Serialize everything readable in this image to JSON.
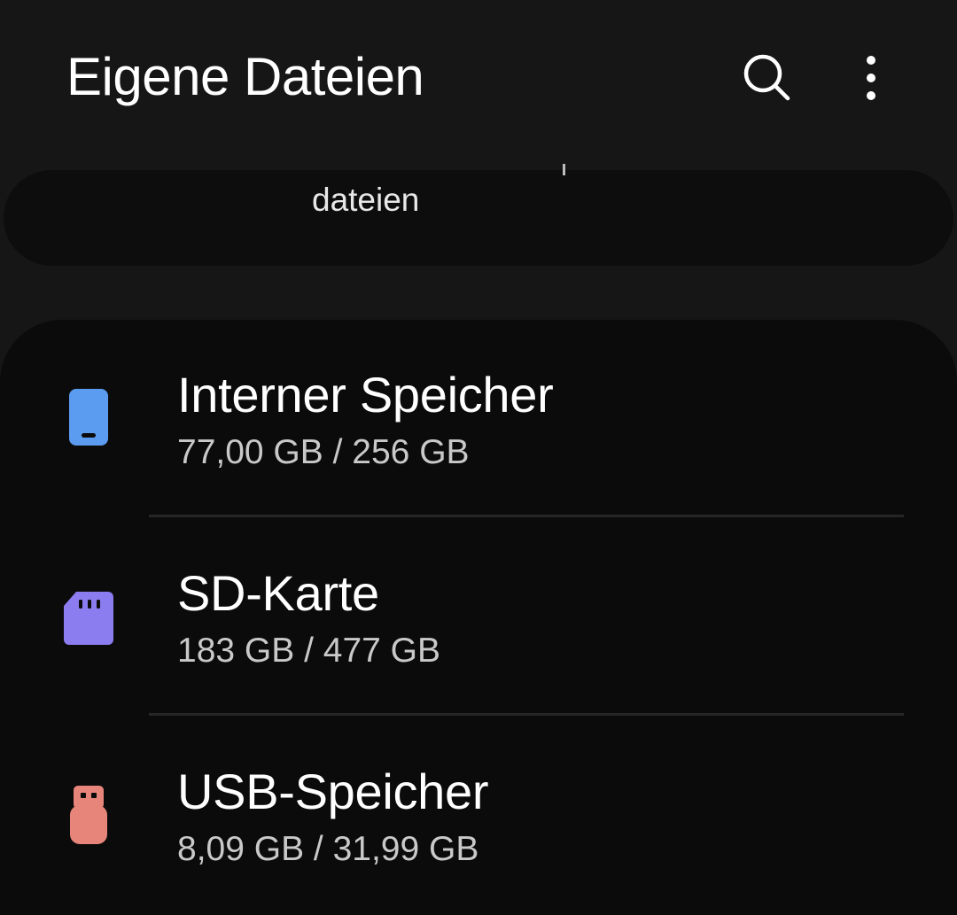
{
  "header": {
    "title": "Eigene Dateien",
    "search_icon": "search-icon",
    "more_icon": "more-vertical-icon"
  },
  "recent": {
    "label": "dateien"
  },
  "storage": {
    "items": [
      {
        "name": "Interner Speicher",
        "usage": "77,00 GB / 256 GB",
        "icon": "phone-icon",
        "color": "#5b9cf0"
      },
      {
        "name": "SD-Karte",
        "usage": "183 GB / 477 GB",
        "icon": "sd-card-icon",
        "color": "#8b7cf0"
      },
      {
        "name": "USB-Speicher",
        "usage": "8,09 GB / 31,99 GB",
        "icon": "usb-drive-icon",
        "color": "#e8857a"
      }
    ]
  }
}
